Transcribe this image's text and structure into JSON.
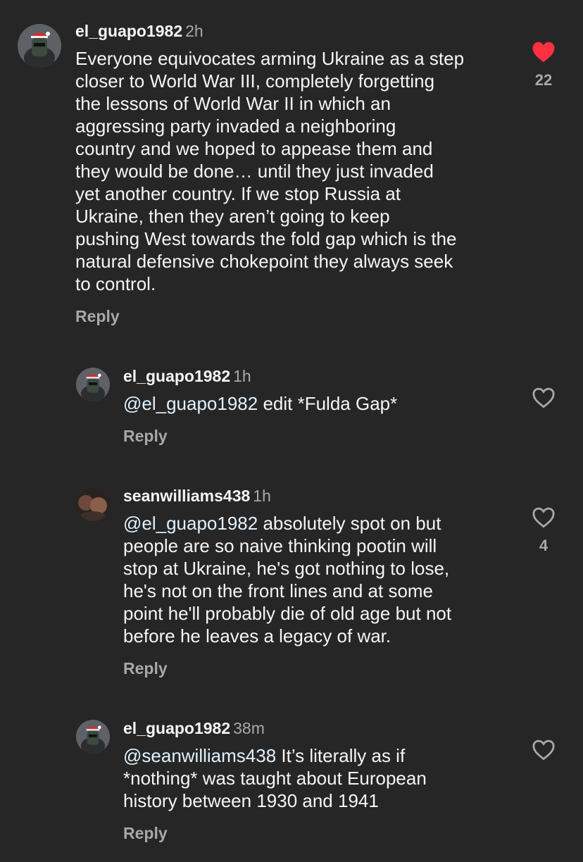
{
  "colors": {
    "background": "#262626",
    "text": "#f5f5f5",
    "muted": "#a8a8a8",
    "liked": "#ff3040",
    "mention": "#e0f1ff"
  },
  "comments": [
    {
      "username": "el_guapo1982",
      "time": "2h",
      "avatar": "user-avatar-helmet",
      "lines": [
        "Everyone equivocates arming Ukraine as a step",
        "closer to World War III, completely forgetting",
        "the lessons of World War II in which an",
        "aggressing party invaded a neighboring",
        "country and we hoped to appease them and",
        "they would be done… until they just invaded",
        "yet another country. If we stop Russia at",
        "Ukraine, then they aren’t going to keep",
        "pushing West towards the fold gap which is the",
        "natural defensive chokepoint they always seek",
        "to control."
      ],
      "reply_label": "Reply",
      "liked": true,
      "like_icon": "heart-filled-icon",
      "like_count": "22"
    },
    {
      "username": "el_guapo1982",
      "time": "1h",
      "avatar": "user-avatar-helmet",
      "mention": "@el_guapo1982",
      "lines": [
        " edit *Fulda Gap*"
      ],
      "reply_label": "Reply",
      "liked": false,
      "like_icon": "heart-outline-icon"
    },
    {
      "username": "seanwilliams438",
      "time": "1h",
      "avatar": "user-avatar-photo",
      "mention": "@el_guapo1982",
      "lines": [
        " absolutely spot on but",
        "people are so naive thinking pootin will",
        "stop at Ukraine, he's got nothing to lose,",
        "he's not on the front lines and at some",
        "point he'll probably die of old age but not",
        "before he leaves a legacy of war."
      ],
      "reply_label": "Reply",
      "liked": false,
      "like_icon": "heart-outline-icon",
      "like_count": "4"
    },
    {
      "username": "el_guapo1982",
      "time": "38m",
      "avatar": "user-avatar-helmet",
      "mention": "@seanwilliams438",
      "lines": [
        " It’s literally as if",
        "*nothing* was taught about European",
        "history between 1930 and 1941"
      ],
      "reply_label": "Reply",
      "liked": false,
      "like_icon": "heart-outline-icon"
    }
  ]
}
